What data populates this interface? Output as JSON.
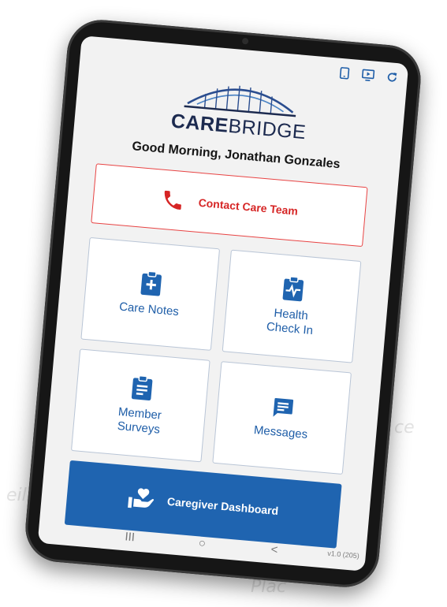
{
  "logo": {
    "text_bold": "CARE",
    "text_light": "BRIDGE"
  },
  "greeting": "Good Morning, Jonathan Gonzales",
  "contact_care_team": {
    "label": "Contact Care Team",
    "icon": "phone-icon"
  },
  "tiles": [
    {
      "label": "Care Notes",
      "icon": "clipboard-plus-icon"
    },
    {
      "label": "Health\nCheck In",
      "icon": "clipboard-pulse-icon"
    },
    {
      "label": "Member\nSurveys",
      "icon": "clipboard-list-icon"
    },
    {
      "label": "Messages",
      "icon": "message-icon"
    }
  ],
  "caregiver_dashboard": {
    "label": "Caregiver Dashboard",
    "icon": "hand-heart-icon"
  },
  "top_icons": [
    "tablet-icon",
    "presentation-icon",
    "refresh-icon"
  ],
  "nav_bar": {
    "recents": "III",
    "home": "○",
    "back": "<"
  },
  "version": "v1.0 (205)",
  "colors": {
    "primary": "#1f64b0",
    "danger": "#d62525",
    "background": "#f2f2f2",
    "logo_text": "#1c2a4f"
  }
}
